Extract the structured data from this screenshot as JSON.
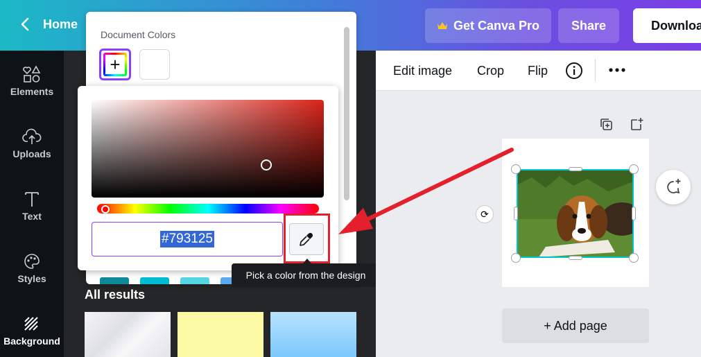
{
  "header": {
    "home_label": "Home",
    "pro_label": "Get Canva Pro",
    "share_label": "Share",
    "download_label": "Download"
  },
  "rail": {
    "items": [
      {
        "label": "Elements",
        "icon": "shapes-icon"
      },
      {
        "label": "Uploads",
        "icon": "cloud-upload-icon"
      },
      {
        "label": "Text",
        "icon": "text-icon"
      },
      {
        "label": "Styles",
        "icon": "palette-icon"
      },
      {
        "label": "Background",
        "icon": "background-icon"
      }
    ]
  },
  "color_panel": {
    "title": "Document Colors",
    "hex_value": "#793125",
    "tooltip": "Pick a color from the design"
  },
  "results": {
    "heading": "All results"
  },
  "toolbar": {
    "edit_image": "Edit image",
    "crop": "Crop",
    "flip": "Flip"
  },
  "canvas": {
    "add_page": "+ Add page"
  },
  "colors": {
    "accent": "#8b3dff",
    "selection": "#00c4cc",
    "annotation_red": "#e3202c"
  }
}
